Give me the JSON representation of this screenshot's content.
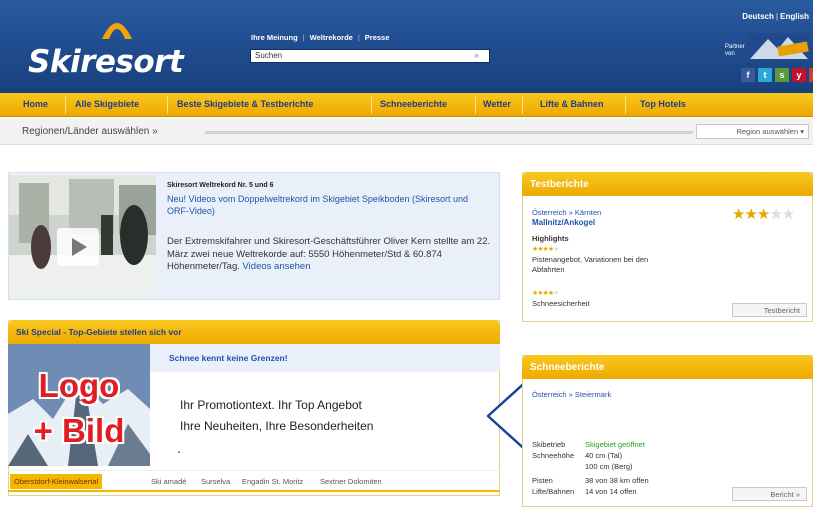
{
  "header": {
    "logo": "Skiresort",
    "toplinks": [
      "Ihre Meinung",
      "Weltrekorde",
      "Presse"
    ],
    "search_value": "Suchen",
    "search_go": "»",
    "languages": [
      "Deutsch",
      "English"
    ],
    "partner_label": "Partner von",
    "colors": {
      "header_blue": "#1f4a8c",
      "nav_yellow": "#f4b800",
      "link_blue": "#2252a8"
    }
  },
  "nav": {
    "items": [
      "Home",
      "Alle Skigebiete",
      "Beste Skigebiete & Testberichte",
      "Schneeberichte",
      "Wetter",
      "Lifte & Bahnen",
      "Top Hotels"
    ]
  },
  "region": {
    "label": "Regionen/Länder auswählen »",
    "select_button": "Region auswählen ▾"
  },
  "teaser": {
    "kicker": "Skiresort Weltrekord Nr. 5 und 6",
    "headline": "Neu! Videos vom Doppelweltrekord im Skigebiet Speikboden (Skiresort und ORF-Video)",
    "body": "Der Extremskifahrer und Skiresort-Geschäftsführer Oliver Kern stellte am 22. März zwei neue Weltrekorde auf: 5550 Höhenmeter/Std & 60.874 Höhenmeter/Tag.",
    "link": "Videos ansehen"
  },
  "special": {
    "header": "Ski Special - Top-Gebiete stellen sich vor",
    "subtitle": "Schnee kennt keine Grenzen!",
    "image_text_1": "Logo",
    "image_text_2": "+ Bild",
    "promo_line_1": "Ihr Promotiontext. Ihr Top Angebot",
    "promo_line_2": "Ihre Neuheiten, Ihre Besonderheiten",
    "promo_dot": ".",
    "tabs": [
      "Oberstdorf-Kleinwalsertal",
      "Ski amadé",
      "Surselva",
      "Engadin St. Moritz",
      "Sextner Dolomiten"
    ]
  },
  "testberichte": {
    "title": "Testberichte",
    "breadcrumb": "Österreich » Kärnten",
    "resort": "Mallnitz/Ankogel",
    "rating": 3,
    "rating_max": 5,
    "highlights_label": "Highlights",
    "highlight_1": "Pistenangebot, Variationen bei den Abfahrten",
    "highlight_1_stars": 4,
    "highlight_2": "Schneesicherheit",
    "highlight_2_stars": 4,
    "button": "Testbericht"
  },
  "schneeberichte": {
    "title": "Schneeberichte",
    "breadcrumb": "Österreich » Steiermark",
    "rows": [
      {
        "label": "Skibetrieb",
        "value": "Skigebiet geöffnet"
      },
      {
        "label": "Schneehöhe",
        "value": "40 cm (Tal)"
      },
      {
        "label": "",
        "value": "100 cm (Berg)"
      },
      {
        "label": "Pisten",
        "value": "38 von 38 km offen"
      },
      {
        "label": "Lifte/Bahnen",
        "value": "14 von 14 offen"
      }
    ],
    "button": "Bericht »"
  }
}
